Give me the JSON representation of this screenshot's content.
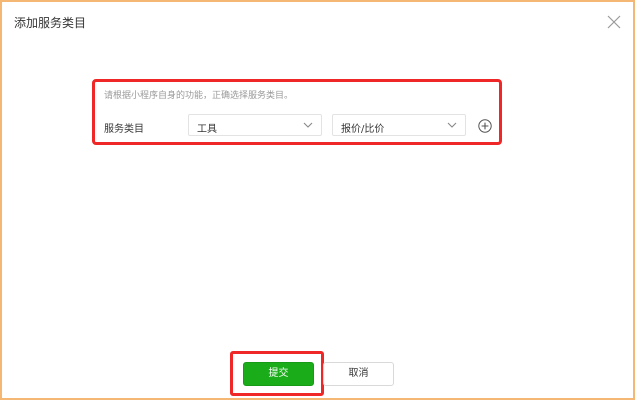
{
  "dialog": {
    "title": "添加服务类目",
    "close_icon": "close-icon"
  },
  "form": {
    "tip": "请根据小程序自身的功能，正确选择服务类目。",
    "label": "服务类目",
    "category_primary": "工具",
    "category_secondary": "报价/比价",
    "add_icon": "plus-circle-icon"
  },
  "buttons": {
    "submit": "提交",
    "cancel": "取消"
  },
  "colors": {
    "highlight": "#f02727",
    "primary": "#1aad19",
    "frame": "#f5b774"
  }
}
